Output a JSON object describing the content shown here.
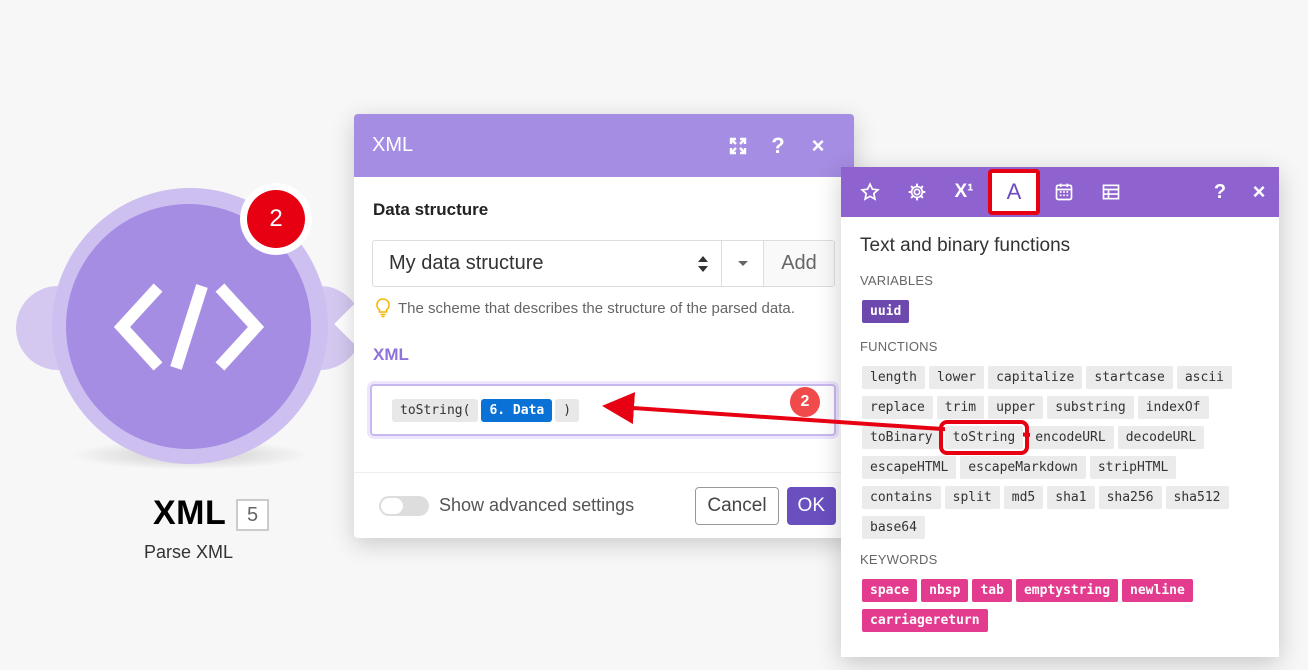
{
  "module": {
    "title": "XML",
    "id": "5",
    "subtitle": "Parse XML",
    "badge": "2"
  },
  "dialog": {
    "title": "XML",
    "data_structure_label": "Data structure",
    "select_value": "My data structure",
    "add_label": "Add",
    "hint": "The scheme that describes the structure of the parsed data.",
    "xml_label": "XML",
    "tokens": {
      "fn_open": "toString(",
      "data": "6. Data",
      "fn_close": ")"
    },
    "advanced_label": "Show advanced settings",
    "cancel_label": "Cancel",
    "ok_label": "OK"
  },
  "panel": {
    "tabs": [
      "star-icon",
      "gear-icon",
      "superscript-icon",
      "text-icon",
      "calendar-icon",
      "table-icon"
    ],
    "active_tab_glyph": "A",
    "superscript_glyph": "X¹",
    "help_glyph": "?",
    "close_glyph": "×",
    "title": "Text and binary functions",
    "variables_label": "VARIABLES",
    "variables": [
      "uuid"
    ],
    "functions_label": "FUNCTIONS",
    "functions": [
      "length",
      "lower",
      "capitalize",
      "startcase",
      "ascii",
      "replace",
      "trim",
      "upper",
      "substring",
      "indexOf",
      "toBinary",
      "toString",
      "encodeURL",
      "decodeURL",
      "escapeHTML",
      "escapeMarkdown",
      "stripHTML",
      "contains",
      "split",
      "md5",
      "sha1",
      "sha256",
      "sha512",
      "base64"
    ],
    "highlighted_function": "toString",
    "keywords_label": "KEYWORDS",
    "keywords": [
      "space",
      "nbsp",
      "tab",
      "emptystring",
      "newline",
      "carriagereturn"
    ]
  },
  "annotation": {
    "step": "2",
    "color": "#e60012"
  }
}
